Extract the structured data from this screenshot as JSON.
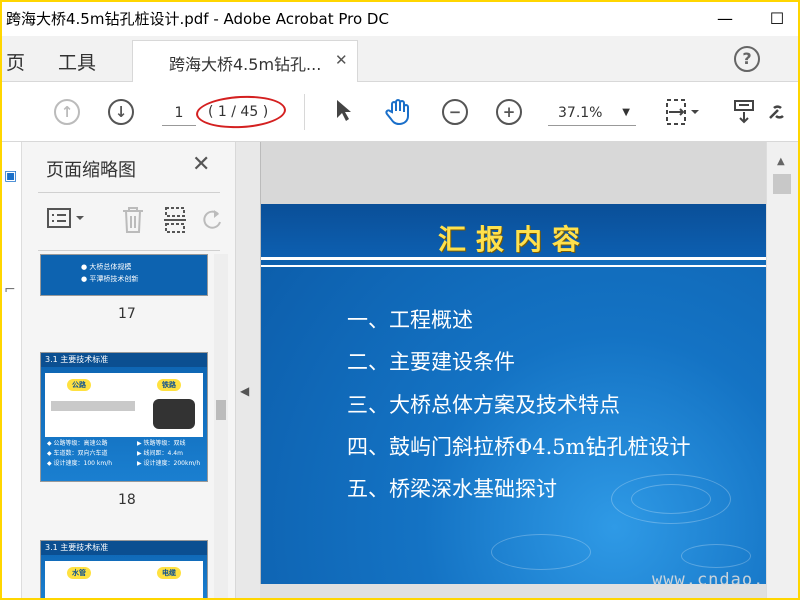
{
  "window": {
    "title": "跨海大桥4.5m钻孔桩设计.pdf - Adobe Acrobat Pro DC",
    "minimize_icon": "minimize-icon",
    "maximize_icon": "maximize-icon"
  },
  "tabs": {
    "home_label": "页",
    "tools_label": "工具",
    "document_tab_label": "跨海大桥4.5m钻孔...",
    "close_symbol": "✕",
    "help_symbol": "?"
  },
  "toolbar": {
    "current_page": "1",
    "page_count": "( 1 / 45 )",
    "zoom": "37.1%",
    "icons": [
      "arrow-up-icon",
      "arrow-down-icon",
      "select-cursor-icon",
      "hand-tool-icon",
      "zoom-out-icon",
      "zoom-in-icon",
      "page-fit-icon",
      "stamp-icon",
      "link-icon"
    ],
    "annotation_color": "#d42020"
  },
  "thumbnail_pane": {
    "title": "页面缩略图",
    "close_symbol": "✕",
    "thumbnails": [
      {
        "page": "17",
        "lines": [
          "● 大桥总体规模",
          "● 平潭桥技术创新"
        ]
      },
      {
        "page": "18",
        "header": "3.1  主要技术标准",
        "badges": [
          "公路",
          "铁路"
        ],
        "footer": [
          "◆ 公路等级：高速公路",
          "◆ 车道数：双向六车道",
          "◆ 设计速度：100 km/h"
        ],
        "footer_right": [
          "▶ 铁路等级：双线",
          "▶ 线间距：4.4m",
          "▶ 设计速度：200km/h"
        ]
      },
      {
        "page": "",
        "header": "3.1  主要技术标准",
        "badges": [
          "水管",
          "电缆"
        ]
      }
    ]
  },
  "slide": {
    "title": "汇报内容",
    "items": [
      "一、工程概述",
      "二、主要建设条件",
      "三、大桥总体方案及技术特点",
      "四、鼓屿门斜拉桥Φ4.5m钻孔桩设计",
      "五、桥梁深水基础探讨"
    ],
    "title_color": "#ffe14d",
    "background_color": "#1473c4"
  },
  "watermark": "www.cndao.com",
  "frame_color": "#ffd600"
}
